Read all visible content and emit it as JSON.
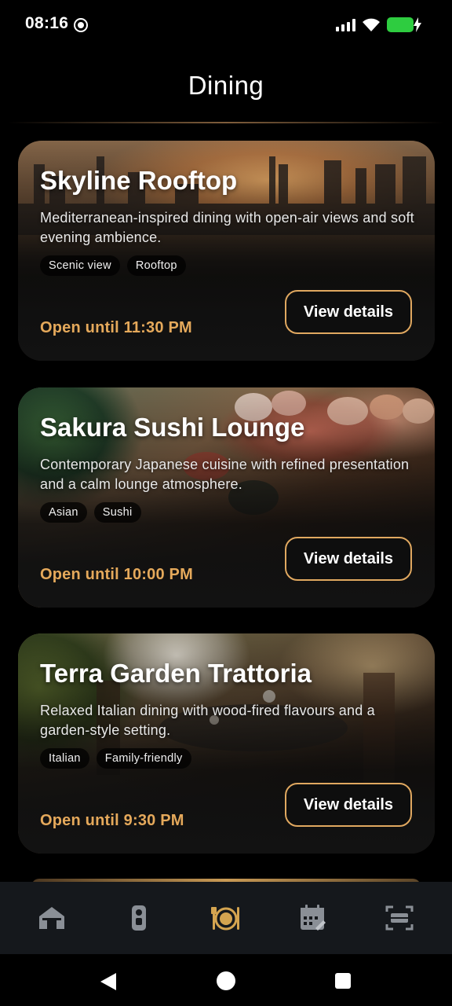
{
  "status_bar": {
    "time": "08:16",
    "icons": [
      "screen-record-icon",
      "cell-signal-icon",
      "wifi-icon",
      "battery-charging-icon"
    ],
    "battery_color": "#2ecc40"
  },
  "header": {
    "title": "Dining"
  },
  "accent_color": "#e5a95b",
  "restaurants": [
    {
      "name": "Skyline Rooftop",
      "description": "Mediterranean-inspired dining with open-air views and soft evening ambience.",
      "tags": [
        "Scenic view",
        "Rooftop"
      ],
      "hours": "Open until 11:30 PM",
      "button_label": "View details",
      "image": "city-skyline-sunset-photo"
    },
    {
      "name": "Sakura Sushi Lounge",
      "description": "Contemporary Japanese cuisine with refined presentation and a calm lounge atmosphere.",
      "tags": [
        "Asian",
        "Sushi"
      ],
      "hours": "Open until 10:00 PM",
      "button_label": "View details",
      "image": "sushi-platter-photo"
    },
    {
      "name": "Terra Garden Trattoria",
      "description": "Relaxed Italian dining with wood-fired flavours and a garden-style setting.",
      "tags": [
        "Italian",
        "Family-friendly"
      ],
      "hours": "Open until 9:30 PM",
      "button_label": "View details",
      "image": "garden-dining-table-photo"
    }
  ],
  "bottom_nav": {
    "items": [
      {
        "icon": "home-icon",
        "active": false
      },
      {
        "icon": "door-key-icon",
        "active": false
      },
      {
        "icon": "dining-plate-icon",
        "active": true
      },
      {
        "icon": "calendar-icon",
        "active": false
      },
      {
        "icon": "scan-icon",
        "active": false
      }
    ],
    "active_color": "#d4a450",
    "inactive_color": "#8a8f96"
  },
  "system_nav": {
    "icons": [
      "back-icon",
      "home-circle-icon",
      "recents-icon"
    ]
  }
}
